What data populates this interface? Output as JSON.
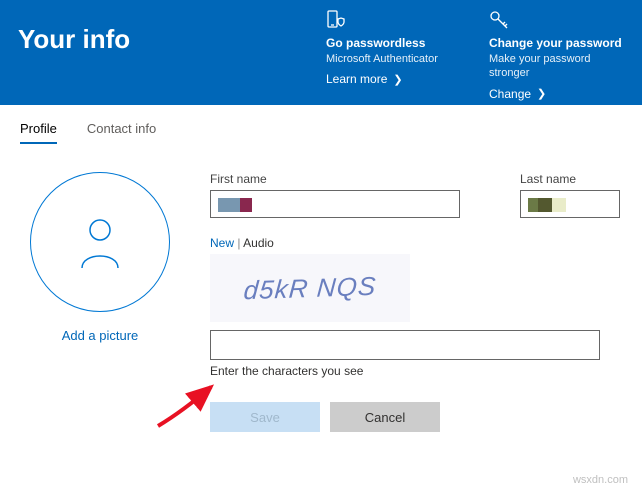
{
  "header": {
    "title": "Your info",
    "passwordless": {
      "title": "Go passwordless",
      "sub": "Microsoft Authenticator",
      "link": "Learn more"
    },
    "changepw": {
      "title": "Change your password",
      "sub": "Make your password stronger",
      "link": "Change"
    }
  },
  "tabs": {
    "profile": "Profile",
    "contact": "Contact info"
  },
  "avatar": {
    "addPicture": "Add a picture"
  },
  "form": {
    "firstNameLabel": "First name",
    "firstNameValue": "",
    "lastNameLabel": "Last name",
    "lastNameValue": ""
  },
  "captcha": {
    "newLabel": "New",
    "audioLabel": "Audio",
    "imageText": "d5kR NQS",
    "instruction": "Enter the characters you see",
    "inputValue": ""
  },
  "buttons": {
    "save": "Save",
    "cancel": "Cancel"
  },
  "watermark": "wsxdn.com"
}
